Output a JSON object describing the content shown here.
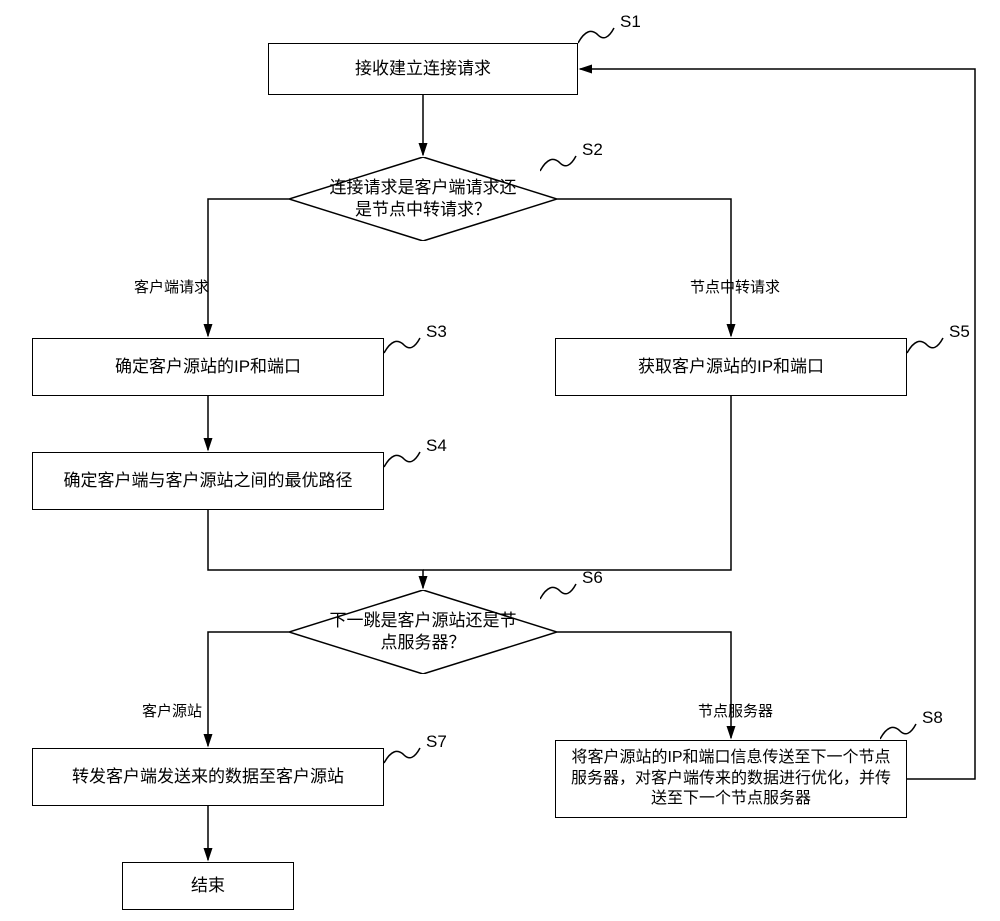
{
  "nodes": {
    "s1": {
      "id": "S1",
      "text": "接收建立连接请求"
    },
    "s2": {
      "id": "S2",
      "text": "连接请求是客户端请求还是节点中转请求？"
    },
    "s3": {
      "id": "S3",
      "text": "确定客户源站的IP和端口"
    },
    "s4": {
      "id": "S4",
      "text": "确定客户端与客户源站之间的最优路径"
    },
    "s5": {
      "id": "S5",
      "text": "获取客户源站的IP和端口"
    },
    "s6": {
      "id": "S6",
      "text": "下一跳是客户源站还是节点服务器？"
    },
    "s7": {
      "id": "S7",
      "text": "转发客户端发送来的数据至客户源站"
    },
    "s8": {
      "id": "S8",
      "text": "将客户源站的IP和端口信息传送至下一个节点服务器，对客户端传来的数据进行优化，并传送至下一个节点服务器"
    },
    "end": {
      "text": "结束"
    }
  },
  "edges": {
    "s2_left": "客户端请求",
    "s2_right": "节点中转请求",
    "s6_left": "客户源站",
    "s6_right": "节点服务器"
  }
}
